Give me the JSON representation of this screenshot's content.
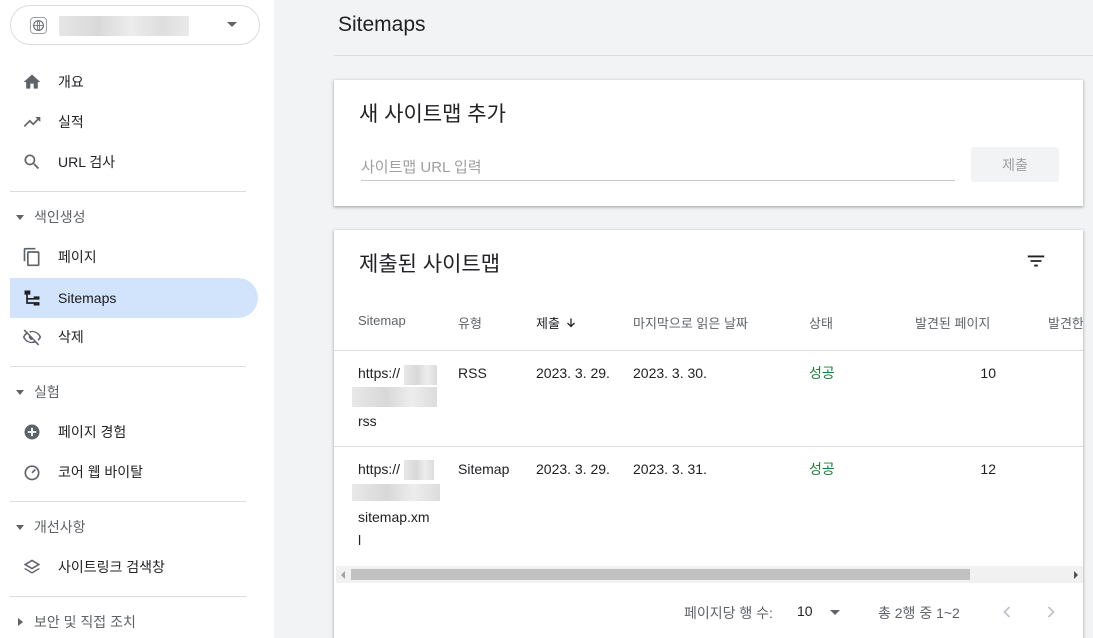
{
  "sidebar": {
    "property_blurred": true,
    "nav": [
      {
        "label": "개요",
        "icon": "home-icon"
      },
      {
        "label": "실적",
        "icon": "trending-up-icon"
      },
      {
        "label": "URL 검사",
        "icon": "search-icon"
      }
    ],
    "sections": [
      {
        "label": "색인생성",
        "expanded": true,
        "items": [
          {
            "label": "페이지",
            "icon": "pages-icon"
          },
          {
            "label": "Sitemaps",
            "icon": "sitemap-icon",
            "active": true
          },
          {
            "label": "삭제",
            "icon": "visibility-off-icon"
          }
        ]
      },
      {
        "label": "실험",
        "expanded": true,
        "items": [
          {
            "label": "페이지 경험",
            "icon": "add-circle-icon"
          },
          {
            "label": "코어 웹 바이탈",
            "icon": "speed-gauge-icon"
          }
        ]
      },
      {
        "label": "개선사항",
        "expanded": true,
        "items": [
          {
            "label": "사이트링크 검색창",
            "icon": "layers-icon"
          }
        ]
      },
      {
        "label": "보안 및 직접 조치",
        "expanded": false,
        "items": []
      }
    ]
  },
  "main": {
    "title": "Sitemaps",
    "add_card": {
      "title": "새 사이트맵 추가",
      "input_placeholder": "사이트맵 URL 입력",
      "input_value": "",
      "submit_label": "제출"
    },
    "submitted_card": {
      "title": "제출된 사이트맵",
      "columns": [
        "Sitemap",
        "유형",
        "제출",
        "마지막으로 읽은 날짜",
        "상태",
        "발견된 페이지",
        "발견한"
      ],
      "sorted_column": "제출",
      "rows": [
        {
          "sitemap_lines": [
            "https://",
            "",
            "rss"
          ],
          "type": "RSS",
          "submitted": "2023. 3. 29.",
          "last_read": "2023. 3. 30.",
          "status": "성공",
          "pages": "10"
        },
        {
          "sitemap_lines": [
            "https://",
            "",
            "sitemap.xm",
            "l"
          ],
          "type": "Sitemap",
          "submitted": "2023. 3. 29.",
          "last_read": "2023. 3. 31.",
          "status": "성공",
          "pages": "12"
        }
      ],
      "pager": {
        "rows_per_page_label": "페이지당 행 수:",
        "rows_per_page": "10",
        "range": "총 2행 중 1~2"
      }
    }
  },
  "colors": {
    "active_nav_bg": "#d2e3fc",
    "success": "#188038",
    "background": "#f1f3f4"
  }
}
